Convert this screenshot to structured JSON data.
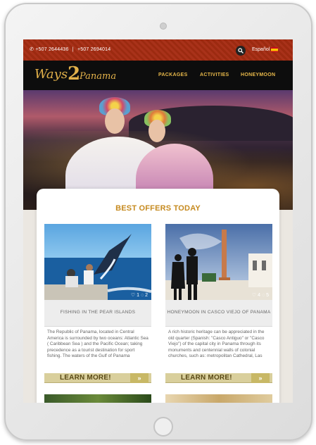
{
  "topbar": {
    "phone1": "+507 2644436",
    "separator": "|",
    "phone2": "+507 2694014",
    "language": "Español"
  },
  "brand": {
    "logo_text_1": "Ways",
    "logo_text_2": "2",
    "logo_text_3": "Panama"
  },
  "nav": {
    "items": [
      {
        "label": "PACKAGES"
      },
      {
        "label": "ACTIVITIES"
      },
      {
        "label": "HONEYMOON"
      }
    ]
  },
  "section": {
    "title": "BEST OFFERS TODAY"
  },
  "offers": [
    {
      "title": "FISHING IN THE PEAR ISLANDS",
      "likes": "1",
      "comments": "2",
      "text": "The Republic of Panama, located in Central America is surrounded by two oceans: Atlantic Sea ( Caribbean Sea ) and the Pacific Ocean; taking precedence as a tourist destination for sport fishing. The waters of the Gulf of Panama",
      "button": "LEARN MORE!"
    },
    {
      "title": "HONEYMOON IN CASCO VIEJO OF PANAMA",
      "likes": "4",
      "comments": "5",
      "text": "A rich historic heritage can be appreciated in the old quarter (Spanish: \"Casco Antiguo\" or \"Casco Viejo\") of the capital city in Panama through its monuments and centennial walls of colonial churches, such as: metropolitan Cathedral, Las",
      "button": "LEARN MORE!"
    }
  ],
  "colors": {
    "accent": "#c68a1f",
    "topbar": "#a3301a",
    "nav_text": "#e7b84a",
    "button_bg": "#d9cf9c"
  },
  "icons": {
    "search": "search-icon",
    "flag": "spain-flag-icon",
    "heart": "heart-icon",
    "comment": "comment-icon",
    "arrows": "double-chevron-right-icon"
  }
}
